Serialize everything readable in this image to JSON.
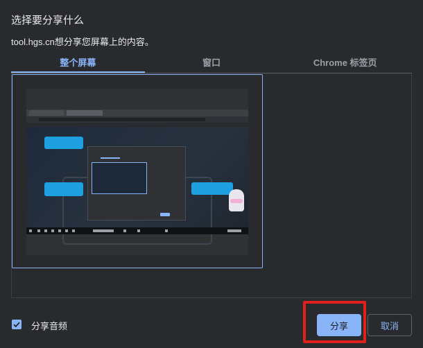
{
  "dialog": {
    "title": "选择要分享什么",
    "subtitle": "tool.hgs.cn想分享您屏幕上的内容。"
  },
  "tabs": [
    {
      "label": "整个屏幕",
      "active": true
    },
    {
      "label": "窗口",
      "active": false
    },
    {
      "label": "Chrome 标签页",
      "active": false
    }
  ],
  "sources": [
    {
      "name": "entire-screen-thumbnail",
      "selected": true
    }
  ],
  "footer": {
    "share_audio_label": "分享音频",
    "share_audio_checked": true,
    "share_button": "分享",
    "cancel_button": "取消"
  },
  "colors": {
    "accent": "#8ab4f8",
    "background": "#292a2d",
    "highlight_box": "#e0201b"
  }
}
